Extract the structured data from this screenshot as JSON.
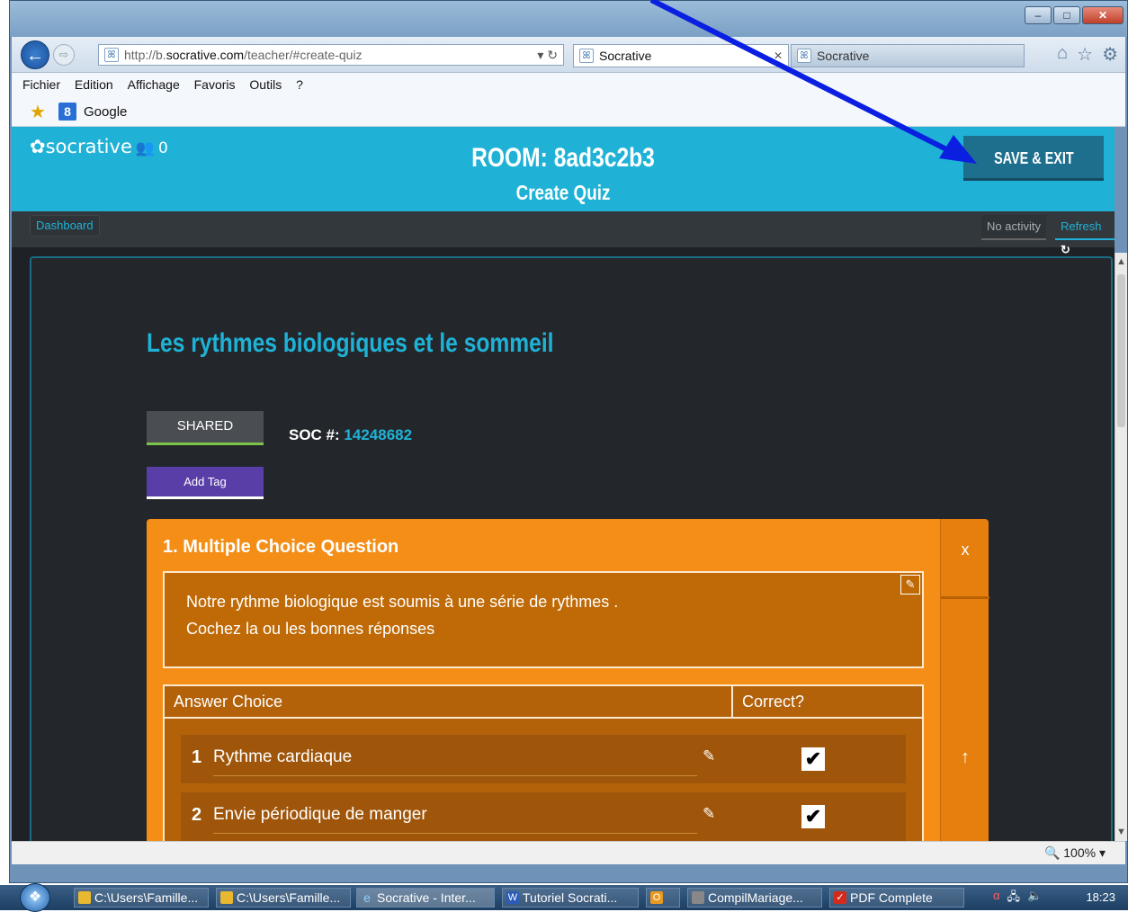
{
  "browser": {
    "url_prefix": "http://b.",
    "url_domain": "socrative.com",
    "url_path": "/teacher/#create-quiz",
    "tab_active": "Socrative",
    "tab_other": "Socrative",
    "menu": [
      "Fichier",
      "Edition",
      "Affichage",
      "Favoris",
      "Outils",
      "?"
    ],
    "favorite": "Google",
    "zoom": "100%"
  },
  "app": {
    "logo": "socrative",
    "student_count": "0",
    "room_title": "ROOM: 8ad3c2b3",
    "subtitle": "Create Quiz",
    "save_label": "SAVE & EXIT",
    "dashboard_label": "Dashboard",
    "activity_label": "No activity",
    "refresh_label": "Refresh"
  },
  "quiz": {
    "title": "Les rythmes biologiques et le sommeil",
    "shared_label": "SHARED",
    "soc_label": "SOC #:",
    "soc_number": "14248682",
    "tag_label": "Add Tag",
    "question": {
      "heading": "1. Multiple Choice Question",
      "text_line1": "Notre rythme biologique est soumis à une série de rythmes .",
      "text_line2": "Cochez la ou les bonnes réponses",
      "col_answer": "Answer Choice",
      "col_correct": "Correct?",
      "close_label": "x",
      "answers": [
        {
          "num": "1",
          "text": "Rythme cardiaque",
          "correct": true
        },
        {
          "num": "2",
          "text": "Envie périodique de manger",
          "correct": true
        }
      ]
    }
  },
  "taskbar": {
    "items": [
      "C:\\Users\\Famille...",
      "C:\\Users\\Famille...",
      "Socrative - Inter...",
      "Tutoriel Socrati...",
      "",
      "CompilMariage...",
      "PDF Complete"
    ],
    "clock": "18:23"
  },
  "colors": {
    "accent": "#1fb2d6",
    "question_card": "#f48e17",
    "annotation_arrow": "#0a1fe0"
  }
}
